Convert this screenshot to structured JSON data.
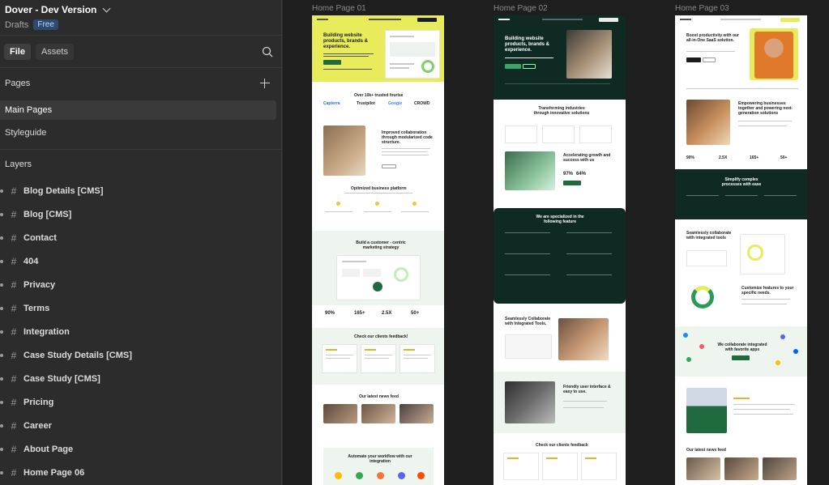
{
  "project": {
    "title": "Dover - Dev Version",
    "drafts": "Drafts",
    "plan": "Free"
  },
  "tabs": {
    "file": "File",
    "assets": "Assets"
  },
  "pages": {
    "heading": "Pages",
    "items": [
      {
        "label": "Main Pages"
      },
      {
        "label": "Styleguide"
      }
    ]
  },
  "layers": {
    "heading": "Layers",
    "items": [
      {
        "label": "Blog Details [CMS]"
      },
      {
        "label": "Blog [CMS]"
      },
      {
        "label": "Contact"
      },
      {
        "label": "404"
      },
      {
        "label": "Privacy"
      },
      {
        "label": "Terms"
      },
      {
        "label": "Integration"
      },
      {
        "label": "Case Study Details [CMS]"
      },
      {
        "label": "Case Study [CMS]"
      },
      {
        "label": "Pricing"
      },
      {
        "label": "Career"
      },
      {
        "label": "About Page"
      },
      {
        "label": "Home Page 06"
      }
    ]
  },
  "frames": [
    {
      "label": "Home Page 01"
    },
    {
      "label": "Home Page 02"
    },
    {
      "label": "Home Page 03"
    }
  ],
  "hp1": {
    "hero": "Building website products, brands & experience.",
    "trusted": "Over 10k+ trusted fourlse",
    "brands": [
      "Capterra",
      "Trustpilot",
      "Google",
      "CROWD"
    ],
    "collab": "Improved collaboration through modularized code structure.",
    "optimized": "Optimized business platform",
    "customer": "Build a customer - centric marketing strategy",
    "stats": [
      "90%",
      "165+",
      "2.5X",
      "50+"
    ],
    "feedback": "Check our clients feedback!",
    "news": "Our latest news feed",
    "automate": "Automate your workflow with our integration"
  },
  "hp2": {
    "hero": "Building website products, brands & experience.",
    "transform": "Transforming industries through innovative solutions",
    "accel": "Accelerating growth and success with us",
    "stats": [
      "97%",
      "64%"
    ],
    "special": "We are specialized in the following feature",
    "seamless": "Seamlessly Collaborate with Integrated Tools.",
    "friendly": "Friendly user interface & easy to use.",
    "feedback": "Check our clients feedback"
  },
  "hp3": {
    "hero": "Boost productivity with our all-in-One SaaS solution.",
    "empower": "Empowering businesses together and powering next-generation solutions",
    "stats": [
      "90%",
      "2.5X",
      "165+",
      "50+"
    ],
    "simplify": "Simplify complex processes with ease",
    "seamless": "Seamlessly collaborate with integrated tools",
    "customize": "Customize features to your specific needs.",
    "collaborate": "We collaborate integrated with favorite apps",
    "news": "Our latest news feed"
  },
  "colors": {
    "lime": "#e8ec5a",
    "forest": "#0f2a22",
    "mint": "#eef4ee",
    "accent": "#1f6b3f"
  }
}
